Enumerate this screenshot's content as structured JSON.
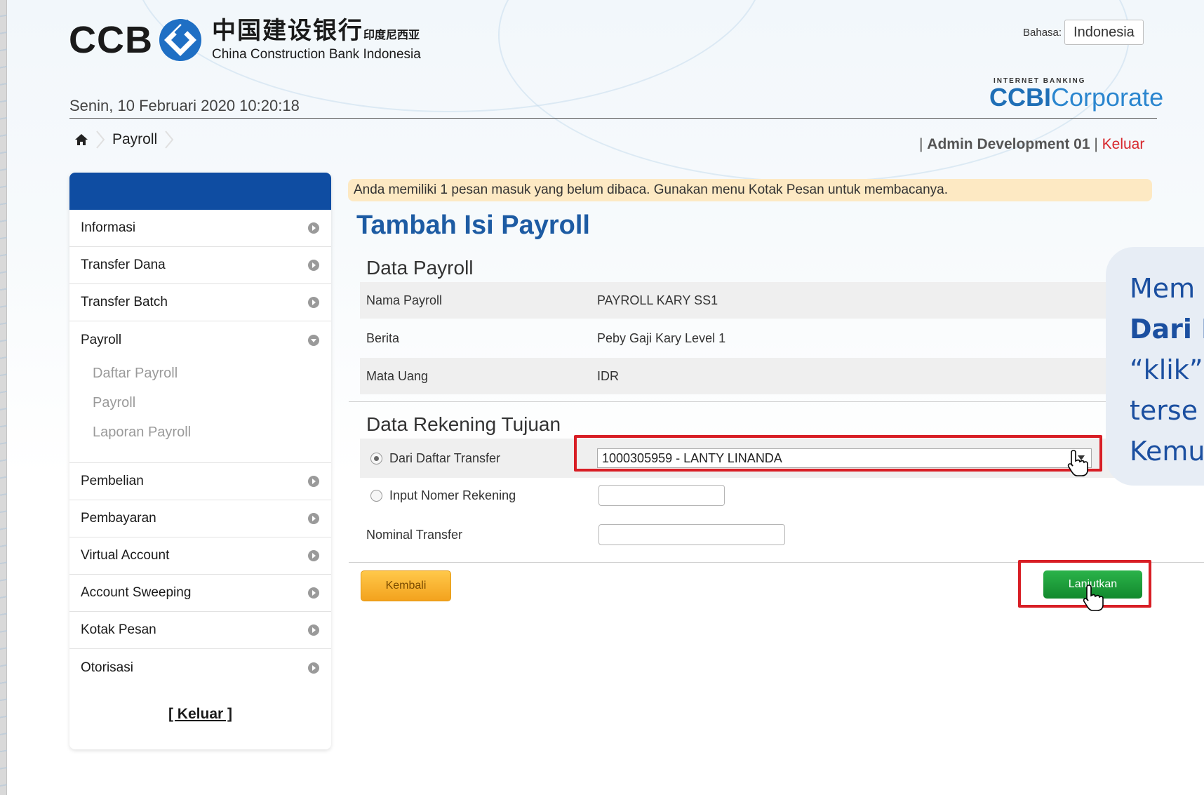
{
  "header": {
    "logo_latin": "CCB",
    "logo_chinese": "中国建设银行",
    "logo_chinese_small": "印度尼西亚",
    "logo_english": "China Construction Bank Indonesia",
    "language_label": "Bahasa:",
    "language_value": "Indonesia",
    "brand_small": "INTERNET BANKING",
    "brand_bold": "CCBI",
    "brand_light": "Corporate",
    "datetime": "Senin, 10 Februari 2020 10:20:18",
    "breadcrumb": "Payroll",
    "user_prefix": "| ",
    "user_name": "Admin Development 01",
    "user_sep": " | ",
    "logout": "Keluar"
  },
  "sidebar": {
    "items_top": [
      {
        "label": "Informasi"
      },
      {
        "label": "Transfer Dana"
      },
      {
        "label": "Transfer Batch"
      }
    ],
    "payroll_group": {
      "label": "Payroll",
      "sub": [
        "Daftar Payroll",
        "Payroll",
        "Laporan Payroll"
      ]
    },
    "items_bottom": [
      {
        "label": "Pembelian"
      },
      {
        "label": "Pembayaran"
      },
      {
        "label": "Virtual Account"
      },
      {
        "label": "Account Sweeping"
      },
      {
        "label": "Kotak Pesan"
      },
      {
        "label": "Otorisasi"
      }
    ],
    "logout": "[ Keluar ]"
  },
  "main": {
    "notice": "Anda memiliki 1 pesan masuk yang belum dibaca. Gunakan menu Kotak Pesan untuk membacanya.",
    "title": "Tambah Isi Payroll",
    "data_payroll": {
      "heading": "Data Payroll",
      "rows": [
        {
          "label": "Nama Payroll",
          "value": "PAYROLL KARY SS1"
        },
        {
          "label": "Berita",
          "value": "Peby Gaji Kary Level 1"
        },
        {
          "label": "Mata Uang",
          "value": "IDR"
        }
      ]
    },
    "rekening": {
      "heading": "Data Rekening Tujuan",
      "option_daftar": "Dari Daftar Transfer",
      "selected_account": "1000305959 - LANTY LINANDA",
      "option_input": "Input Nomer Rekening",
      "nominal_label": "Nominal Transfer",
      "input_value": "",
      "nominal_value": ""
    },
    "btn_back": "Kembali",
    "btn_next": "Lanjutkan"
  },
  "callout": {
    "line1": "Mem",
    "line2": "Dari D",
    "line3": "“klik”",
    "line4": "terse",
    "line5": "Kemu"
  },
  "colors": {
    "brand_blue": "#0f4da2",
    "title_blue": "#1d5ba3",
    "highlight_red": "#d81e25",
    "next_green": "#12892d",
    "back_orange": "#f3a21d"
  }
}
